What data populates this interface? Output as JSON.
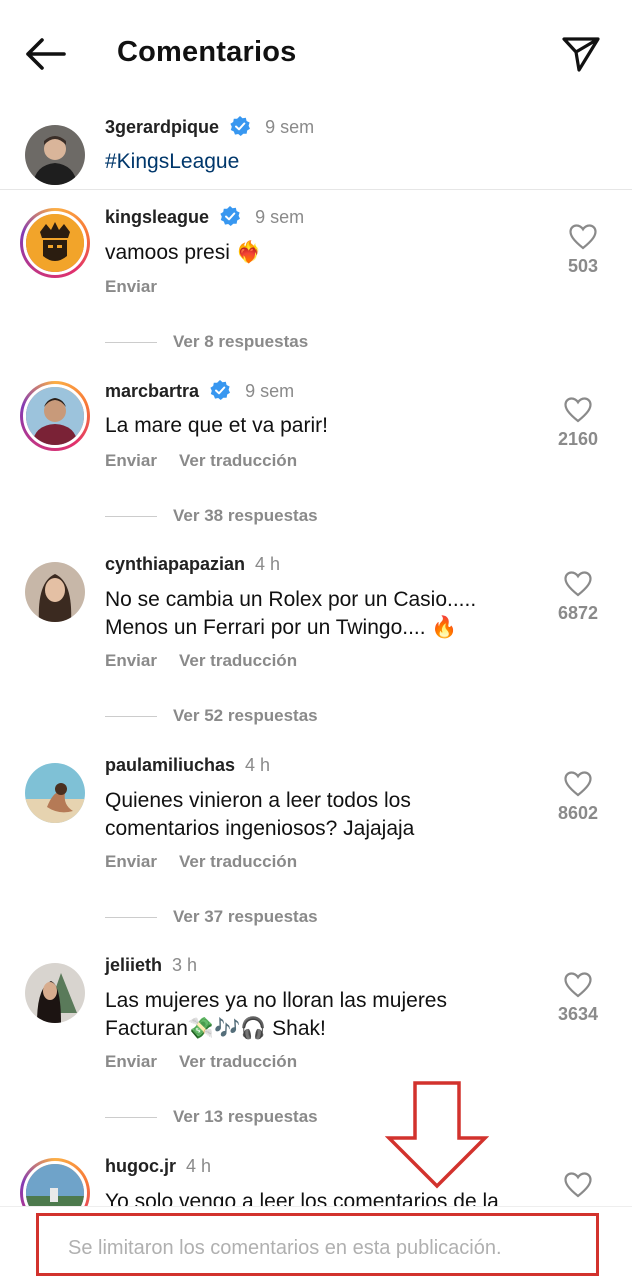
{
  "header": {
    "title": "Comentarios"
  },
  "caption": {
    "username": "3gerardpique",
    "time": "9 sem",
    "text": "#KingsLeague"
  },
  "comments": [
    {
      "username": "kingsleague",
      "time": "9 sem",
      "text": "vamoos presi ❤️‍🔥",
      "actions": [
        "Enviar"
      ],
      "likes": "503",
      "replies": "Ver 8 respuestas"
    },
    {
      "username": "marcbartra",
      "time": "9 sem",
      "text": "La mare que et va parir!",
      "actions": [
        "Enviar",
        "Ver traducción"
      ],
      "likes": "2160",
      "replies": "Ver 38 respuestas"
    },
    {
      "username": "cynthiapapazian",
      "time": "4 h",
      "text_line1": "No se cambia un Rolex por un Casio.....",
      "text_line2": "Menos un Ferrari por un Twingo.... 🔥",
      "actions": [
        "Enviar",
        "Ver traducción"
      ],
      "likes": "6872",
      "replies": "Ver 52 respuestas"
    },
    {
      "username": "paulamiliuchas",
      "time": "4 h",
      "text_line1": "Quienes vinieron a leer todos los",
      "text_line2": "comentarios ingeniosos? Jajajaja",
      "actions": [
        "Enviar",
        "Ver traducción"
      ],
      "likes": "8602",
      "replies": "Ver 37 respuestas"
    },
    {
      "username": "jeliieth",
      "time": "3 h",
      "text_line1": "Las mujeres ya no lloran las mujeres",
      "text_line2": "Facturan💸🎶🎧 Shak!",
      "actions": [
        "Enviar",
        "Ver traducción"
      ],
      "likes": "3634",
      "replies": "Ver 13 respuestas"
    },
    {
      "username": "hugoc.jr",
      "time": "4 h",
      "text": "Yo solo vengo a leer los comentarios de la"
    }
  ],
  "footer": {
    "text": "Se limitaron los comentarios en esta publicación."
  },
  "colors": {
    "verified": "#3897f0",
    "annotation": "#d2322d",
    "hashtag": "#00376b"
  }
}
